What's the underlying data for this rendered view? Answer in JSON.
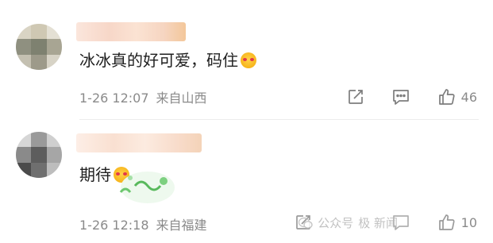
{
  "comments": [
    {
      "text": "冰冰真的好可爱，码住",
      "time": "1-26 12:07",
      "location": "来自山西",
      "likes": "46",
      "emoji": "heart-eyes-emoji"
    },
    {
      "text": "期待",
      "time": "1-26 12:18",
      "location": "来自福建",
      "likes": "10",
      "emoji": "cheering-emoji"
    }
  ],
  "watermark": {
    "source": "公众号",
    "name": "极 新闻"
  },
  "icons": {
    "share": "share-icon",
    "reply": "comment-icon",
    "like": "thumbs-up-icon"
  }
}
